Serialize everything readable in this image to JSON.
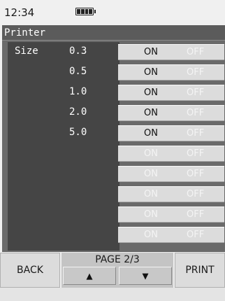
{
  "status": {
    "time": "12:34"
  },
  "panel": {
    "title": "Printer"
  },
  "settings": {
    "size_label": "Size",
    "rows": [
      {
        "value": "0.3",
        "on": "ON",
        "off": "OFF"
      },
      {
        "value": "0.5",
        "on": "ON",
        "off": "OFF"
      },
      {
        "value": "1.0",
        "on": "ON",
        "off": "OFF"
      },
      {
        "value": "2.0",
        "on": "ON",
        "off": "OFF"
      },
      {
        "value": "5.0",
        "on": "ON",
        "off": "OFF"
      },
      {
        "value": "",
        "on": "ON",
        "off": "OFF"
      },
      {
        "value": "",
        "on": "ON",
        "off": "OFF"
      },
      {
        "value": "",
        "on": "ON",
        "off": "OFF"
      },
      {
        "value": "",
        "on": "ON",
        "off": "OFF"
      },
      {
        "value": "",
        "on": "ON",
        "off": "OFF"
      }
    ]
  },
  "nav": {
    "back_label": "BACK",
    "page_label": "PAGE 2/3",
    "up_icon": "▲",
    "down_icon": "▼",
    "print_label": "PRINT"
  }
}
